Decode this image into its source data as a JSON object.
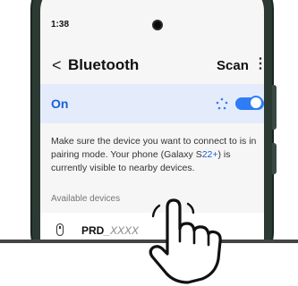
{
  "status_bar": {
    "time": "1:38"
  },
  "header": {
    "back_icon": "chevron-left",
    "title": "Bluetooth",
    "scan_label": "Scan",
    "more_icon": "⋮"
  },
  "toggle": {
    "label": "On",
    "state": "on",
    "accent": "#2e7cf6"
  },
  "description": {
    "text_before": "Make sure the device you want to connect to is in pairing mode. Your phone (Galaxy S",
    "highlight": "22+",
    "text_after": ") is currently visible to nearby devices."
  },
  "available": {
    "section_label": "Available devices",
    "devices": [
      {
        "name_prefix": "PRD",
        "name_suffix": "_XXXX",
        "icon": "mouse-icon"
      }
    ]
  }
}
